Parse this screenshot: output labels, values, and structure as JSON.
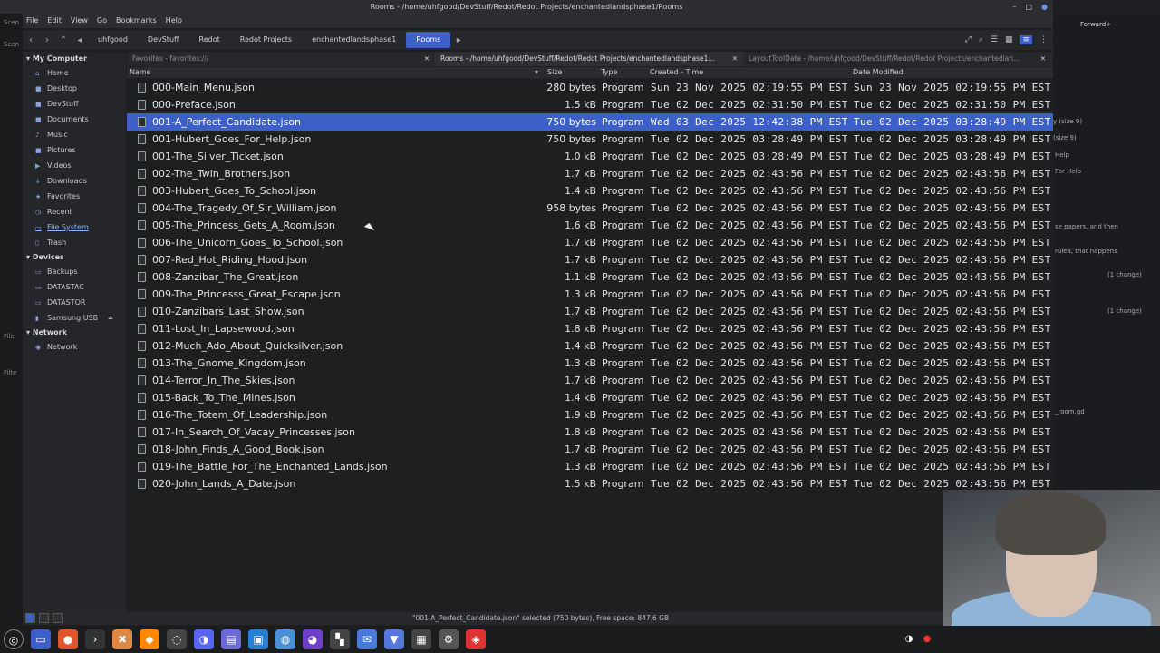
{
  "window": {
    "title": "Rooms - /home/uhfgood/DevStuff/Redot/Redot Projects/enchantedlandsphase1/Rooms"
  },
  "menu": [
    "File",
    "Edit",
    "View",
    "Go",
    "Bookmarks",
    "Help"
  ],
  "breadcrumbs": [
    "uhfgood",
    "DevStuff",
    "Redot",
    "Redot Projects",
    "enchantedlandsphase1",
    "Rooms"
  ],
  "sidebar": {
    "my_computer": "My Computer",
    "places": [
      {
        "label": "Home",
        "icon": "home-icon"
      },
      {
        "label": "Desktop",
        "icon": "desktop-icon"
      },
      {
        "label": "DevStuff",
        "icon": "folder-icon"
      },
      {
        "label": "Documents",
        "icon": "documents-icon"
      },
      {
        "label": "Music",
        "icon": "music-icon"
      },
      {
        "label": "Pictures",
        "icon": "pictures-icon"
      },
      {
        "label": "Videos",
        "icon": "videos-icon"
      },
      {
        "label": "Downloads",
        "icon": "downloads-icon"
      },
      {
        "label": "Favorites",
        "icon": "star-icon"
      },
      {
        "label": "Recent",
        "icon": "recent-icon"
      },
      {
        "label": "File System",
        "icon": "drive-icon"
      },
      {
        "label": "Trash",
        "icon": "trash-icon"
      }
    ],
    "devices_header": "Devices",
    "devices": [
      {
        "label": "Backups"
      },
      {
        "label": "DATASTAC"
      },
      {
        "label": "DATASTOR"
      },
      {
        "label": "Samsung USB"
      }
    ],
    "network_header": "Network",
    "network": [
      {
        "label": "Network"
      }
    ]
  },
  "tabs": [
    {
      "label": "Favorites - favorites:///"
    },
    {
      "label": "Rooms - /home/uhfgood/DevStuff/Redot/Redot Projects/enchantedlandsphase1..."
    },
    {
      "label": "LayoutToolData - /home/uhfgood/DevStuff/Redot/Redot Projects/enchantedlan..."
    }
  ],
  "columns": {
    "name": "Name",
    "size": "Size",
    "type": "Type",
    "created": "Created - Time",
    "modified": "Date Modified"
  },
  "files": [
    {
      "name": "000-Main_Menu.json",
      "size": "280 bytes",
      "type": "Program",
      "created": "Sun 23 Nov 2025 02:19:55 PM EST",
      "modified": "Sun 23 Nov 2025 02:19:55 PM EST"
    },
    {
      "name": "000-Preface.json",
      "size": "1.5 kB",
      "type": "Program",
      "created": "Tue 02 Dec 2025 02:31:50 PM EST",
      "modified": "Tue 02 Dec 2025 02:31:50 PM EST"
    },
    {
      "name": "001-A_Perfect_Candidate.json",
      "size": "750 bytes",
      "type": "Program",
      "created": "Wed 03 Dec 2025 12:42:38 PM EST",
      "modified": "Tue 02 Dec 2025 03:28:49 PM EST",
      "selected": true
    },
    {
      "name": "001-Hubert_Goes_For_Help.json",
      "size": "750 bytes",
      "type": "Program",
      "created": "Tue 02 Dec 2025 03:28:49 PM EST",
      "modified": "Tue 02 Dec 2025 03:28:49 PM EST"
    },
    {
      "name": "001-The_Silver_Ticket.json",
      "size": "1.0 kB",
      "type": "Program",
      "created": "Tue 02 Dec 2025 03:28:49 PM EST",
      "modified": "Tue 02 Dec 2025 03:28:49 PM EST"
    },
    {
      "name": "002-The_Twin_Brothers.json",
      "size": "1.7 kB",
      "type": "Program",
      "created": "Tue 02 Dec 2025 02:43:56 PM EST",
      "modified": "Tue 02 Dec 2025 02:43:56 PM EST"
    },
    {
      "name": "003-Hubert_Goes_To_School.json",
      "size": "1.4 kB",
      "type": "Program",
      "created": "Tue 02 Dec 2025 02:43:56 PM EST",
      "modified": "Tue 02 Dec 2025 02:43:56 PM EST"
    },
    {
      "name": "004-The_Tragedy_Of_Sir_William.json",
      "size": "958 bytes",
      "type": "Program",
      "created": "Tue 02 Dec 2025 02:43:56 PM EST",
      "modified": "Tue 02 Dec 2025 02:43:56 PM EST"
    },
    {
      "name": "005-The_Princess_Gets_A_Room.json",
      "size": "1.6 kB",
      "type": "Program",
      "created": "Tue 02 Dec 2025 02:43:56 PM EST",
      "modified": "Tue 02 Dec 2025 02:43:56 PM EST"
    },
    {
      "name": "006-The_Unicorn_Goes_To_School.json",
      "size": "1.7 kB",
      "type": "Program",
      "created": "Tue 02 Dec 2025 02:43:56 PM EST",
      "modified": "Tue 02 Dec 2025 02:43:56 PM EST"
    },
    {
      "name": "007-Red_Hot_Riding_Hood.json",
      "size": "1.7 kB",
      "type": "Program",
      "created": "Tue 02 Dec 2025 02:43:56 PM EST",
      "modified": "Tue 02 Dec 2025 02:43:56 PM EST"
    },
    {
      "name": "008-Zanzibar_The_Great.json",
      "size": "1.1 kB",
      "type": "Program",
      "created": "Tue 02 Dec 2025 02:43:56 PM EST",
      "modified": "Tue 02 Dec 2025 02:43:56 PM EST"
    },
    {
      "name": "009-The_Princesss_Great_Escape.json",
      "size": "1.3 kB",
      "type": "Program",
      "created": "Tue 02 Dec 2025 02:43:56 PM EST",
      "modified": "Tue 02 Dec 2025 02:43:56 PM EST"
    },
    {
      "name": "010-Zanzibars_Last_Show.json",
      "size": "1.7 kB",
      "type": "Program",
      "created": "Tue 02 Dec 2025 02:43:56 PM EST",
      "modified": "Tue 02 Dec 2025 02:43:56 PM EST"
    },
    {
      "name": "011-Lost_In_Lapsewood.json",
      "size": "1.8 kB",
      "type": "Program",
      "created": "Tue 02 Dec 2025 02:43:56 PM EST",
      "modified": "Tue 02 Dec 2025 02:43:56 PM EST"
    },
    {
      "name": "012-Much_Ado_About_Quicksilver.json",
      "size": "1.4 kB",
      "type": "Program",
      "created": "Tue 02 Dec 2025 02:43:56 PM EST",
      "modified": "Tue 02 Dec 2025 02:43:56 PM EST"
    },
    {
      "name": "013-The_Gnome_Kingdom.json",
      "size": "1.3 kB",
      "type": "Program",
      "created": "Tue 02 Dec 2025 02:43:56 PM EST",
      "modified": "Tue 02 Dec 2025 02:43:56 PM EST"
    },
    {
      "name": "014-Terror_In_The_Skies.json",
      "size": "1.7 kB",
      "type": "Program",
      "created": "Tue 02 Dec 2025 02:43:56 PM EST",
      "modified": "Tue 02 Dec 2025 02:43:56 PM EST"
    },
    {
      "name": "015-Back_To_The_Mines.json",
      "size": "1.4 kB",
      "type": "Program",
      "created": "Tue 02 Dec 2025 02:43:56 PM EST",
      "modified": "Tue 02 Dec 2025 02:43:56 PM EST"
    },
    {
      "name": "016-The_Totem_Of_Leadership.json",
      "size": "1.9 kB",
      "type": "Program",
      "created": "Tue 02 Dec 2025 02:43:56 PM EST",
      "modified": "Tue 02 Dec 2025 02:43:56 PM EST"
    },
    {
      "name": "017-In_Search_Of_Vacay_Princesses.json",
      "size": "1.8 kB",
      "type": "Program",
      "created": "Tue 02 Dec 2025 02:43:56 PM EST",
      "modified": "Tue 02 Dec 2025 02:43:56 PM EST"
    },
    {
      "name": "018-John_Finds_A_Good_Book.json",
      "size": "1.7 kB",
      "type": "Program",
      "created": "Tue 02 Dec 2025 02:43:56 PM EST",
      "modified": "Tue 02 Dec 2025 02:43:56 PM EST"
    },
    {
      "name": "019-The_Battle_For_The_Enchanted_Lands.json",
      "size": "1.3 kB",
      "type": "Program",
      "created": "Tue 02 Dec 2025 02:43:56 PM EST",
      "modified": "Tue 02 Dec 2025 02:43:56 PM EST"
    },
    {
      "name": "020-John_Lands_A_Date.json",
      "size": "1.5 kB",
      "type": "Program",
      "created": "Tue 02 Dec 2025 02:43:56 PM EST",
      "modified": "Tue 02 Dec 2025 02:43:56 PM EST"
    }
  ],
  "status": "\"001-A_Perfect_Candidate.json\" selected (750 bytes), Free space: 847.6 GB",
  "right_panel": {
    "snippets": [
      "Forward+",
      "y (size 9)",
      "(size 9)",
      "Help",
      "For Help",
      "se papers, and then",
      "rulea, that happens",
      "(1 change)",
      "(1 change)",
      "_room.gd"
    ]
  },
  "colors": {
    "accent": "#3d5fc8",
    "bg": "#1e1f21"
  }
}
